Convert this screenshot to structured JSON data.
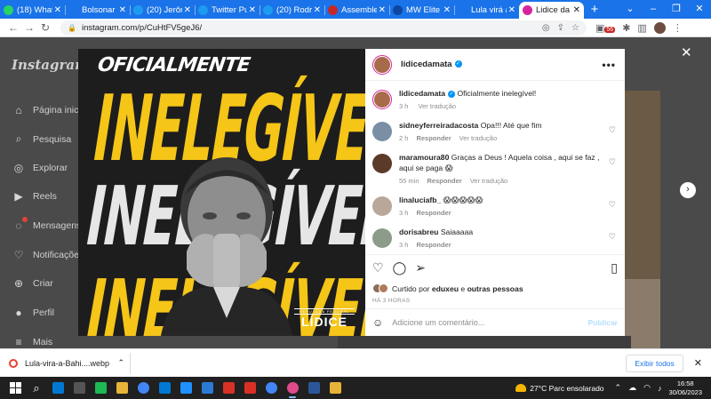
{
  "tabs": [
    {
      "title": "(18) What",
      "color": "#25d366",
      "active": false
    },
    {
      "title": "Bolsonar",
      "color": "#1a73e8",
      "active": false
    },
    {
      "title": "(20) Jerôn",
      "color": "#1d9bf0",
      "active": false
    },
    {
      "title": "Twitter Pu",
      "color": "#1d9bf0",
      "active": false
    },
    {
      "title": "(20) Rodrig",
      "color": "#1d9bf0",
      "active": false
    },
    {
      "title": "Assemblei",
      "color": "#c62828",
      "active": false
    },
    {
      "title": "MW Elite |",
      "color": "#0d47a1",
      "active": false
    },
    {
      "title": "Lula virá à",
      "color": "#1a73e8",
      "active": false
    },
    {
      "title": "Lidice da",
      "color": "#d6249f",
      "active": true
    }
  ],
  "browser": {
    "url": "instagram.com/p/CuHtFV5geJ6/",
    "ext_badge": "56"
  },
  "instagram": {
    "logo": "Instagram",
    "nav": [
      {
        "label": "Página inicial",
        "icon": "home-icon"
      },
      {
        "label": "Pesquisa",
        "icon": "search-icon"
      },
      {
        "label": "Explorar",
        "icon": "compass-icon"
      },
      {
        "label": "Reels",
        "icon": "reels-icon"
      },
      {
        "label": "Mensagens",
        "icon": "messenger-icon"
      },
      {
        "label": "Notificações",
        "icon": "heart-icon"
      },
      {
        "label": "Criar",
        "icon": "plus-icon"
      },
      {
        "label": "Perfil",
        "icon": "avatar-icon"
      },
      {
        "label": "Mais",
        "icon": "menu-icon"
      }
    ]
  },
  "poster": {
    "line1": "OFICIALMENTE",
    "line2": "INELEGÍVEL",
    "line3": "INELEGÍVEL",
    "line4": "INELEGÍVEL",
    "brand_small": "DEPUTADA FEDERAL",
    "brand_big": "LÍDICE"
  },
  "post": {
    "username": "lidicedamata",
    "caption": "Oficialmente inelegível!",
    "caption_time": "3 h",
    "see_translation": "Ver tradução",
    "reply": "Responder",
    "comments": [
      {
        "user": "sidneyferreiradacosta",
        "text": "Opa!!! Até que fim",
        "time": "2 h",
        "avatar": "#7a8fa6",
        "translation": true
      },
      {
        "user": "maramoura80",
        "text": "Graças a Deus ! Aquela coisa , aqui se faz , aqui se paga 😱",
        "time": "55 min",
        "avatar": "#5b3a29",
        "translation": true
      },
      {
        "user": "linaluciafb_",
        "text": "😱😱😱😱😱",
        "time": "3 h",
        "avatar": "#b9a89a",
        "translation": false
      },
      {
        "user": "dorisabreu",
        "text": "Saiaaaaa",
        "time": "3 h",
        "avatar": "#8d9b8a",
        "translation": false
      }
    ],
    "liked_prefix": "Curtido por",
    "liked_user": "eduxeu",
    "liked_and": "e",
    "liked_others": "outras pessoas",
    "ago": "HÁ 3 HORAS",
    "add_comment": "Adicione um comentário...",
    "publish": "Publicar"
  },
  "downloads": {
    "file": "Lula-vira-a-Bahi....webp",
    "show_all": "Exibir todos"
  },
  "taskbar": {
    "weather": "27°C  Parc ensolarado",
    "time": "16:58",
    "date": "30/06/2023",
    "apps": [
      "#0078d4",
      "#555555",
      "#1db954",
      "#e8b339",
      "#4285f4",
      "#0078d4",
      "#1e90ff",
      "#2b7bd6",
      "#d93025",
      "#d93025",
      "#4285f4",
      "#e04a8a",
      "#2b579a",
      "#e8b339"
    ]
  }
}
